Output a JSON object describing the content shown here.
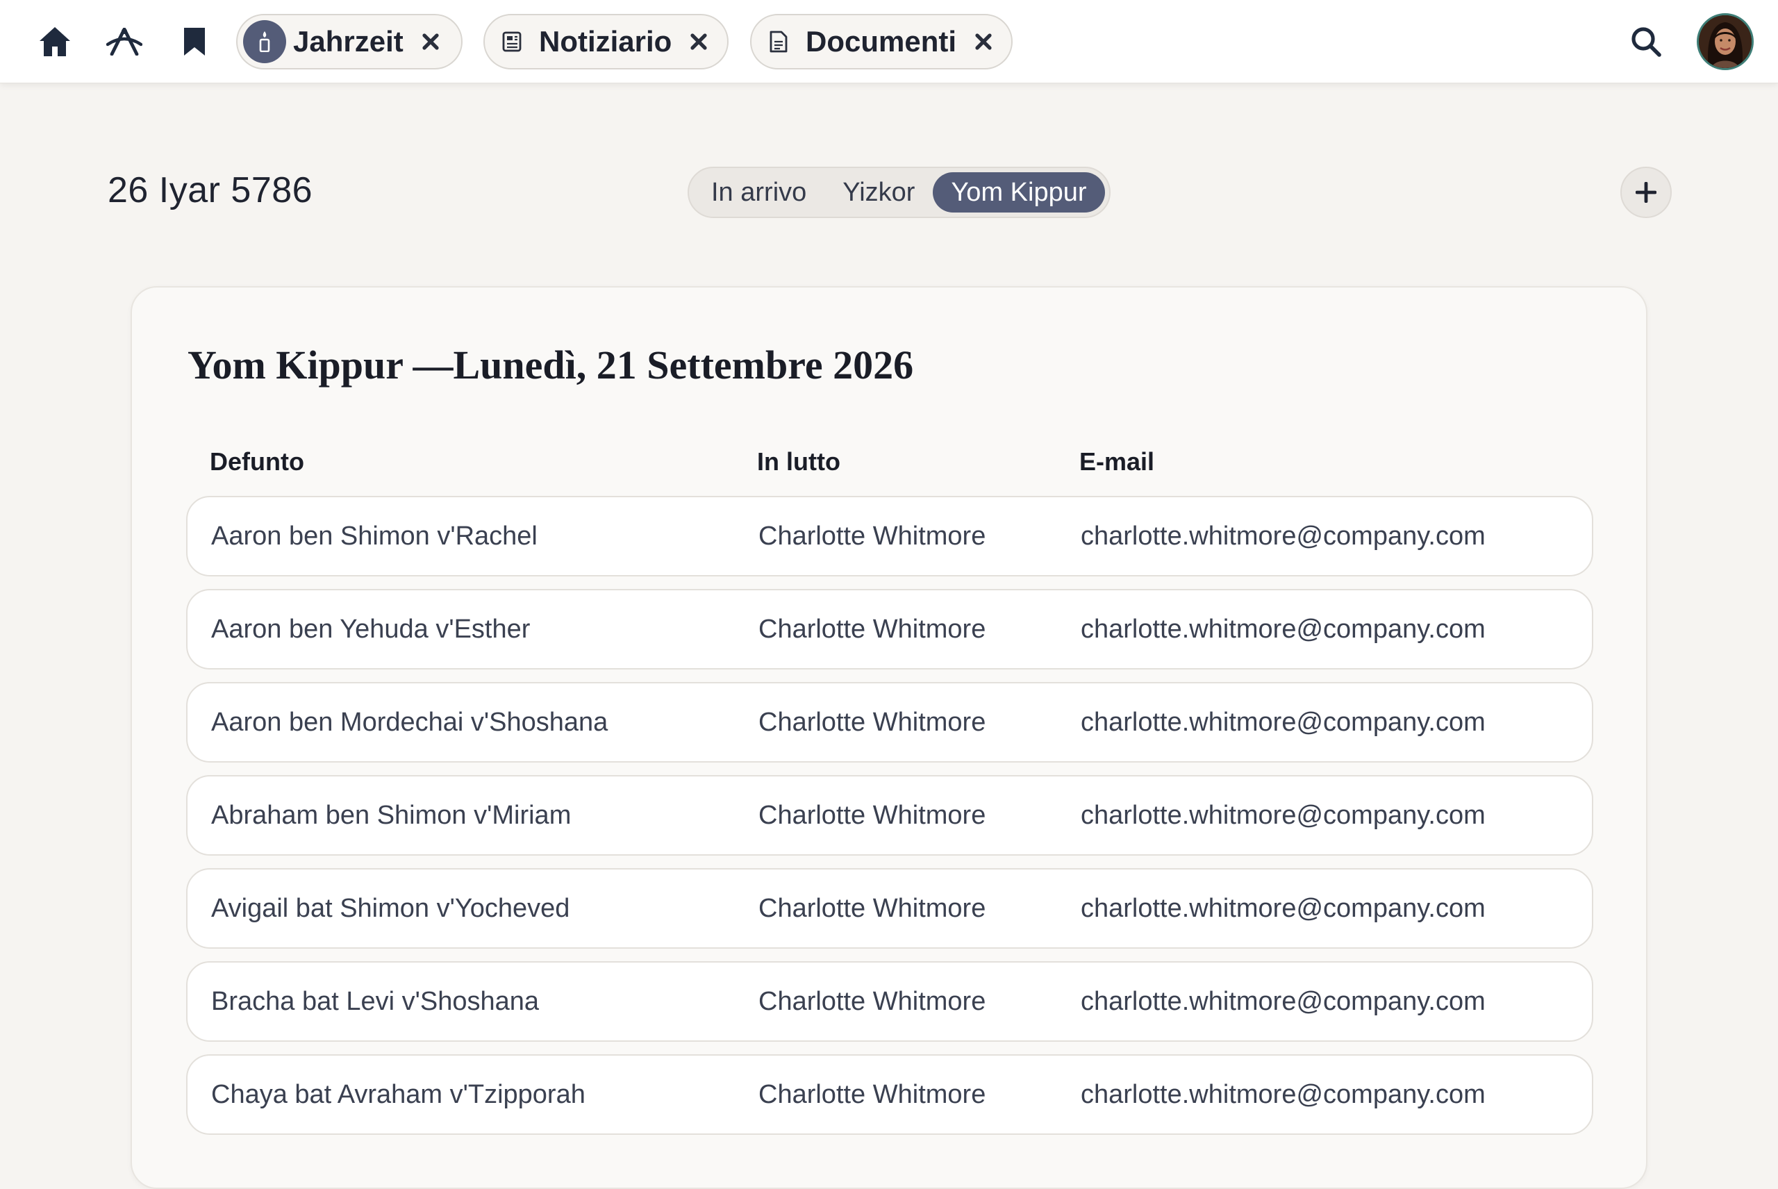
{
  "tabs": [
    {
      "label": "Jahrzeit"
    },
    {
      "label": "Notiziario"
    },
    {
      "label": "Documenti"
    }
  ],
  "header": {
    "date": "26 Iyar 5786",
    "segments": [
      "In arrivo",
      "Yizkor",
      "Yom Kippur"
    ],
    "active_segment": "Yom Kippur",
    "add_symbol": "+"
  },
  "card": {
    "title": "Yom Kippur —Lunedì, 21 Settembre 2026",
    "columns": [
      "Defunto",
      "In lutto",
      "E-mail"
    ],
    "rows": [
      {
        "deceased": "Aaron ben Shimon v'Rachel",
        "mourner": "Charlotte Whitmore",
        "email": "charlotte.whitmore@company.com"
      },
      {
        "deceased": "Aaron ben Yehuda v'Esther",
        "mourner": "Charlotte Whitmore",
        "email": "charlotte.whitmore@company.com"
      },
      {
        "deceased": "Aaron ben Mordechai v'Shoshana",
        "mourner": "Charlotte Whitmore",
        "email": "charlotte.whitmore@company.com"
      },
      {
        "deceased": "Abraham ben Shimon v'Miriam",
        "mourner": "Charlotte Whitmore",
        "email": "charlotte.whitmore@company.com"
      },
      {
        "deceased": "Avigail bat Shimon v'Yocheved",
        "mourner": "Charlotte Whitmore",
        "email": "charlotte.whitmore@company.com"
      },
      {
        "deceased": "Bracha bat Levi v'Shoshana",
        "mourner": "Charlotte Whitmore",
        "email": "charlotte.whitmore@company.com"
      },
      {
        "deceased": "Chaya bat Avraham v'Tzipporah",
        "mourner": "Charlotte Whitmore",
        "email": "charlotte.whitmore@company.com"
      }
    ]
  },
  "icons": {
    "home": "home-icon",
    "tools": "compass-tools-icon",
    "bookmark": "bookmark-icon",
    "candle": "candle-icon",
    "newspaper": "newspaper-icon",
    "document": "document-icon",
    "close": "close-icon",
    "search": "search-icon",
    "add": "plus-icon"
  },
  "colors": {
    "accent": "#545c78",
    "background": "#f6f4f1",
    "card": "#faf9f7",
    "row": "#ffffff"
  }
}
